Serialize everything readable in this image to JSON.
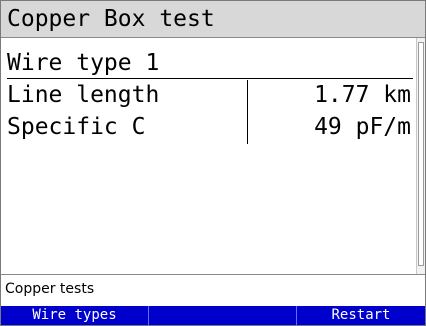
{
  "title": "Copper Box test",
  "section": {
    "header": "Wire type 1"
  },
  "rows": [
    {
      "label": "Line length",
      "value": "1.77 km"
    },
    {
      "label": "Specific C",
      "value": "49 pF/m"
    }
  ],
  "status": {
    "text": "Copper tests"
  },
  "softkeys": [
    {
      "label": "Wire types"
    },
    {
      "label": ""
    },
    {
      "label": "Restart"
    }
  ],
  "colors": {
    "title_bg": "#d8d8d8",
    "softkey_bg": "#0000cc",
    "softkey_text": "#ffffff"
  }
}
